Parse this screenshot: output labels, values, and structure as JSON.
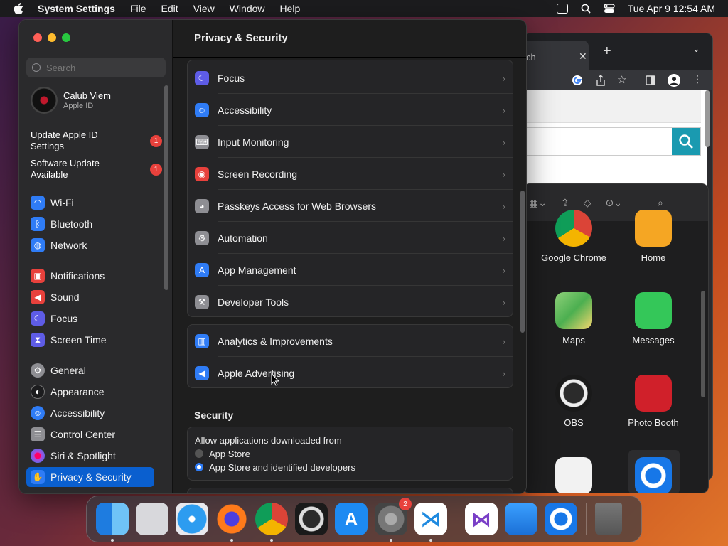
{
  "menubar": {
    "app_name": "System Settings",
    "menus": [
      "File",
      "Edit",
      "View",
      "Window",
      "Help"
    ],
    "clock": "Tue Apr 9  12:54 AM"
  },
  "chrome_bg": {
    "tab_title": "ch",
    "close": "✕",
    "new_tab": "+",
    "chevron": "⌄"
  },
  "launchpad_bg": {
    "apps": [
      {
        "label": "Google Chrome",
        "color": "#e9e9e9"
      },
      {
        "label": "Home",
        "color": "#f5a623"
      },
      {
        "label": "Maps",
        "color": "#4caf50"
      },
      {
        "label": "Messages",
        "color": "#34c759"
      },
      {
        "label": "OBS",
        "color": "#2b2b2b"
      },
      {
        "label": "Photo Booth",
        "color": "#d0202a"
      }
    ]
  },
  "sidebar": {
    "search_placeholder": "Search",
    "account_name": "Calub Viem",
    "account_sub": "Apple ID",
    "notifications": [
      {
        "label": "Update Apple ID Settings",
        "badge": "1"
      },
      {
        "label": "Software Update Available",
        "badge": "1"
      }
    ],
    "items": [
      {
        "label": "Wi-Fi",
        "color": "#2f7cf6"
      },
      {
        "label": "Bluetooth",
        "color": "#2f7cf6"
      },
      {
        "label": "Network",
        "color": "#2f7cf6"
      },
      {
        "label": "Notifications",
        "color": "#e8413c"
      },
      {
        "label": "Sound",
        "color": "#e8413c"
      },
      {
        "label": "Focus",
        "color": "#5e5ce6"
      },
      {
        "label": "Screen Time",
        "color": "#5e5ce6"
      },
      {
        "label": "General",
        "color": "#8e8e93"
      },
      {
        "label": "Appearance",
        "color": "#1c1c1e"
      },
      {
        "label": "Accessibility",
        "color": "#2f7cf6"
      },
      {
        "label": "Control Center",
        "color": "#8e8e93"
      },
      {
        "label": "Siri & Spotlight",
        "color": "#b04ad9"
      },
      {
        "label": "Privacy & Security",
        "color": "#2f7cf6"
      }
    ]
  },
  "content": {
    "title": "Privacy & Security",
    "group1": [
      {
        "label": "Focus",
        "color": "#5e5ce6"
      },
      {
        "label": "Accessibility",
        "color": "#2f7cf6"
      },
      {
        "label": "Input Monitoring",
        "color": "#8e8e93"
      },
      {
        "label": "Screen Recording",
        "color": "#e8413c"
      },
      {
        "label": "Passkeys Access for Web Browsers",
        "color": "#8e8e93"
      },
      {
        "label": "Automation",
        "color": "#8e8e93"
      },
      {
        "label": "App Management",
        "color": "#2f7cf6"
      },
      {
        "label": "Developer Tools",
        "color": "#8e8e93"
      }
    ],
    "group2": [
      {
        "label": "Analytics & Improvements",
        "color": "#2f7cf6"
      },
      {
        "label": "Apple Advertising",
        "color": "#2f7cf6"
      }
    ],
    "security_title": "Security",
    "allow_label": "Allow applications downloaded from",
    "radio_options": [
      {
        "label": "App Store",
        "selected": false
      },
      {
        "label": "App Store and identified developers",
        "selected": true
      }
    ]
  },
  "dock": {
    "settings_badge": "2"
  }
}
